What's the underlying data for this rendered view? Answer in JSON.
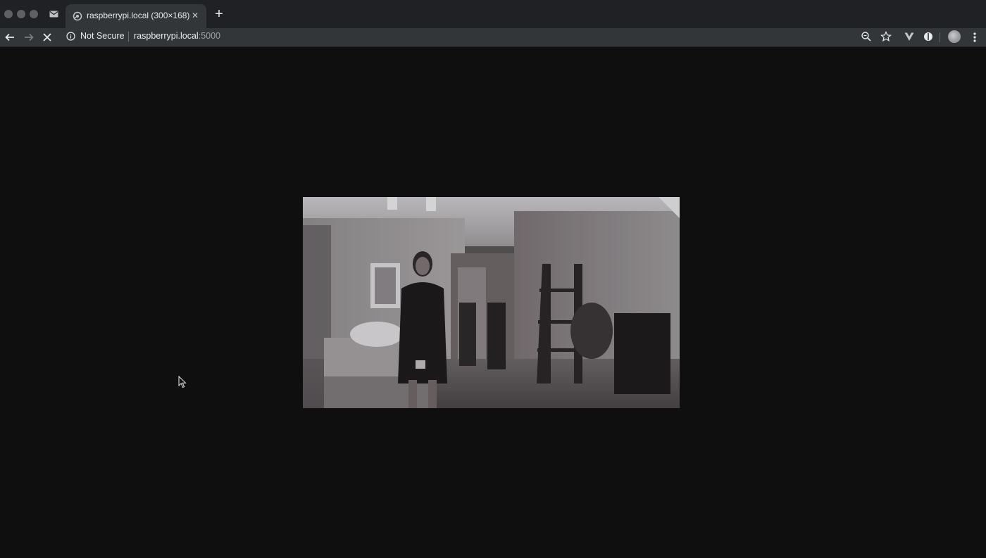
{
  "window": {
    "tab": {
      "title": "raspberrypi.local (300×168)",
      "close_glyph": "✕"
    },
    "new_tab_glyph": "+",
    "icons": {
      "mail": "mail-icon",
      "favicon": "camera-favicon-icon"
    }
  },
  "toolbar": {
    "security_label": "Not Secure",
    "url_host": "raspberrypi.local",
    "url_port": ":5000",
    "icons": [
      "back-arrow-icon",
      "forward-arrow-icon",
      "stop-loading-icon",
      "info-icon",
      "zoom-icon",
      "star-icon",
      "vue-devtools-icon",
      "extension-icon",
      "profile-avatar",
      "menu-icon"
    ]
  },
  "content": {
    "stream": {
      "description_icon": "live-camera-stream",
      "native_size": "300×168"
    }
  },
  "colors": {
    "tabstrip": "#202124",
    "toolbar": "#323639",
    "page_background": "#0f0f10",
    "text": "#e8eaed"
  }
}
